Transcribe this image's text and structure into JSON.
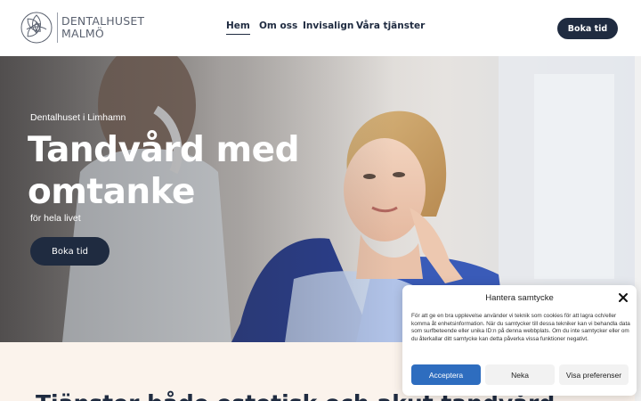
{
  "brand": {
    "name_line1": "DENTALHUSET",
    "name_line2": "MALMÖ",
    "logo_icon": "lotus-icon"
  },
  "nav": {
    "items": [
      {
        "label": "Hem",
        "active": true
      },
      {
        "label": "Om oss",
        "active": false
      },
      {
        "label": "Invisalign",
        "active": false
      },
      {
        "label": "Våra tjänster",
        "active": false
      }
    ],
    "cta_label": "Boka tid"
  },
  "hero": {
    "eyebrow": "Dentalhuset i Limhamn",
    "title": "Tandvård med omtanke",
    "subtitle": "för hela livet",
    "cta_label": "Boka tid"
  },
  "section": {
    "heading": "Tjänster både estetisk och akut tandvård"
  },
  "cookie": {
    "title": "Hantera samtycke",
    "body": "För att ge en bra upplevelse använder vi teknik som cookies för att lagra och/eller komma åt enhetsinformation. När du samtycker till dessa tekniker kan vi behandla data som surfbeteende eller unika ID:n på denna webbplats. Om du inte samtycker eller om du återkallar ditt samtycke kan detta påverka vissa funktioner negativt.",
    "accept_label": "Acceptera",
    "deny_label": "Neka",
    "prefs_label": "Visa preferenser"
  },
  "colors": {
    "navy": "#1f2b40",
    "accept_blue": "#2e6dbf",
    "cream": "#fbf3ec"
  }
}
